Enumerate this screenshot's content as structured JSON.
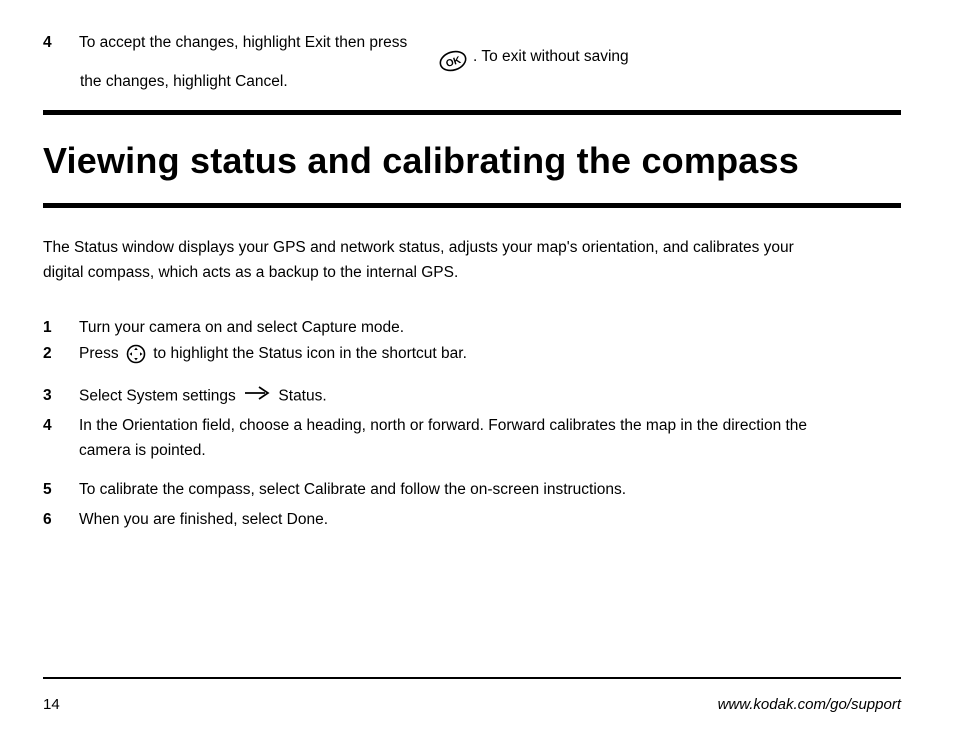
{
  "top": {
    "step_num": "4",
    "line_a": "To accept the changes, highlight Exit then press",
    "line_b": "the changes, highlight Cancel.",
    "ok_icon": "ok-icon",
    "post_icon": ". To exit without saving"
  },
  "heading": "Viewing status and calibrating the compass",
  "intro": "The Status window displays your GPS and network status, adjusts your map's orientation, and calibrates your digital compass, which acts as a backup to the internal GPS.",
  "steps": {
    "s1": {
      "num": "1",
      "text": "Turn your camera on and select Capture mode."
    },
    "s2": {
      "num": "2",
      "text_a": "Press",
      "text_b": "to highlight the Status icon in the shortcut bar.",
      "nav_icon": "nav-icon"
    },
    "s3": {
      "num": "3",
      "text_a": "Select System settings",
      "text_b": "Status.",
      "arrow_icon": "arrow-icon"
    },
    "s4": {
      "num": "4",
      "text": "In the Orientation field, choose a heading, north or forward. Forward calibrates the map in the direction the camera is pointed."
    },
    "s5": {
      "num": "5",
      "text": "To calibrate the compass, select Calibrate and follow the on-screen instructions."
    },
    "s6": {
      "num": "6",
      "text": "When you are finished, select Done."
    }
  },
  "footer": {
    "page": "14",
    "site": "www.kodak.com/go/support"
  }
}
